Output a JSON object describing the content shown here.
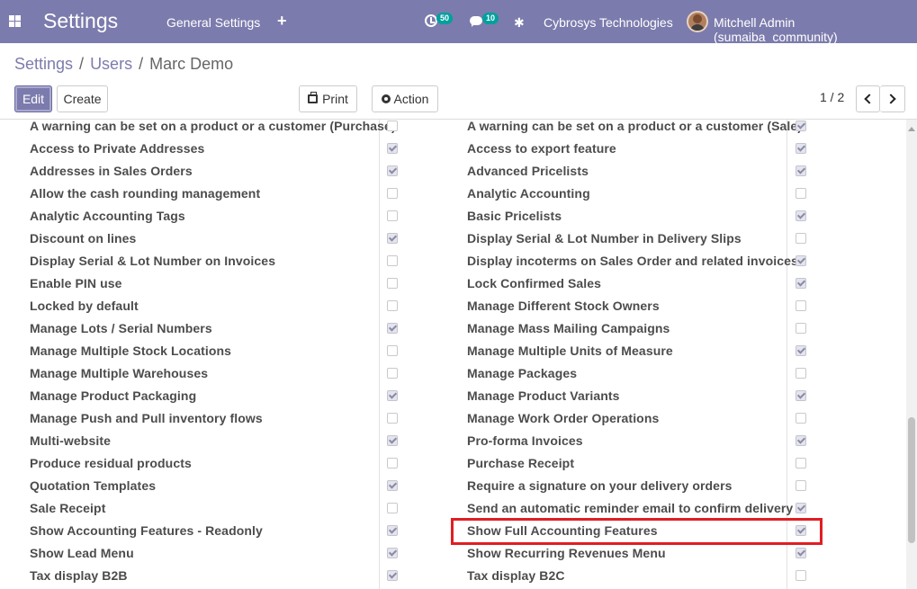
{
  "navbar": {
    "app_title": "Settings",
    "menu_general": "General Settings",
    "menu_plus": "+",
    "activity_count": "50",
    "message_count": "10",
    "company": "Cybrosys Technologies",
    "user": "Mitchell Admin (sumaiba_community)"
  },
  "breadcrumb": {
    "settings": "Settings",
    "users": "Users",
    "current": "Marc Demo",
    "separator": "/"
  },
  "controls": {
    "edit": "Edit",
    "create": "Create",
    "print": "Print",
    "action": "Action",
    "pager": "1 / 2"
  },
  "left_column": [
    {
      "label": "A warning can be set on a product or a customer (Purchase)",
      "checked": false
    },
    {
      "label": "Access to Private Addresses",
      "checked": true
    },
    {
      "label": "Addresses in Sales Orders",
      "checked": true
    },
    {
      "label": "Allow the cash rounding management",
      "checked": false
    },
    {
      "label": "Analytic Accounting Tags",
      "checked": false
    },
    {
      "label": "Discount on lines",
      "checked": true
    },
    {
      "label": "Display Serial & Lot Number on Invoices",
      "checked": false
    },
    {
      "label": "Enable PIN use",
      "checked": false
    },
    {
      "label": "Locked by default",
      "checked": false
    },
    {
      "label": "Manage Lots / Serial Numbers",
      "checked": true
    },
    {
      "label": "Manage Multiple Stock Locations",
      "checked": false
    },
    {
      "label": "Manage Multiple Warehouses",
      "checked": false
    },
    {
      "label": "Manage Product Packaging",
      "checked": true
    },
    {
      "label": "Manage Push and Pull inventory flows",
      "checked": false
    },
    {
      "label": "Multi-website",
      "checked": true
    },
    {
      "label": "Produce residual products",
      "checked": false
    },
    {
      "label": "Quotation Templates",
      "checked": true
    },
    {
      "label": "Sale Receipt",
      "checked": false
    },
    {
      "label": "Show Accounting Features - Readonly",
      "checked": true
    },
    {
      "label": "Show Lead Menu",
      "checked": true
    },
    {
      "label": "Tax display B2B",
      "checked": true
    }
  ],
  "right_column": [
    {
      "label": "A warning can be set on a product or a customer (Sale)",
      "checked": true
    },
    {
      "label": "Access to export feature",
      "checked": true
    },
    {
      "label": "Advanced Pricelists",
      "checked": true
    },
    {
      "label": "Analytic Accounting",
      "checked": false
    },
    {
      "label": "Basic Pricelists",
      "checked": true
    },
    {
      "label": "Display Serial & Lot Number in Delivery Slips",
      "checked": false
    },
    {
      "label": "Display incoterms on Sales Order and related invoices",
      "checked": true
    },
    {
      "label": "Lock Confirmed Sales",
      "checked": true
    },
    {
      "label": "Manage Different Stock Owners",
      "checked": false
    },
    {
      "label": "Manage Mass Mailing Campaigns",
      "checked": false
    },
    {
      "label": "Manage Multiple Units of Measure",
      "checked": true
    },
    {
      "label": "Manage Packages",
      "checked": false
    },
    {
      "label": "Manage Product Variants",
      "checked": true
    },
    {
      "label": "Manage Work Order Operations",
      "checked": false
    },
    {
      "label": "Pro-forma Invoices",
      "checked": true
    },
    {
      "label": "Purchase Receipt",
      "checked": false
    },
    {
      "label": "Require a signature on your delivery orders",
      "checked": false
    },
    {
      "label": "Send an automatic reminder email to confirm delivery",
      "checked": true
    },
    {
      "label": "Show Full Accounting Features",
      "checked": true
    },
    {
      "label": "Show Recurring Revenues Menu",
      "checked": true
    },
    {
      "label": "Tax display B2C",
      "checked": false
    }
  ],
  "highlight_color": "#e01e22",
  "navbar_color": "#7c7bad"
}
